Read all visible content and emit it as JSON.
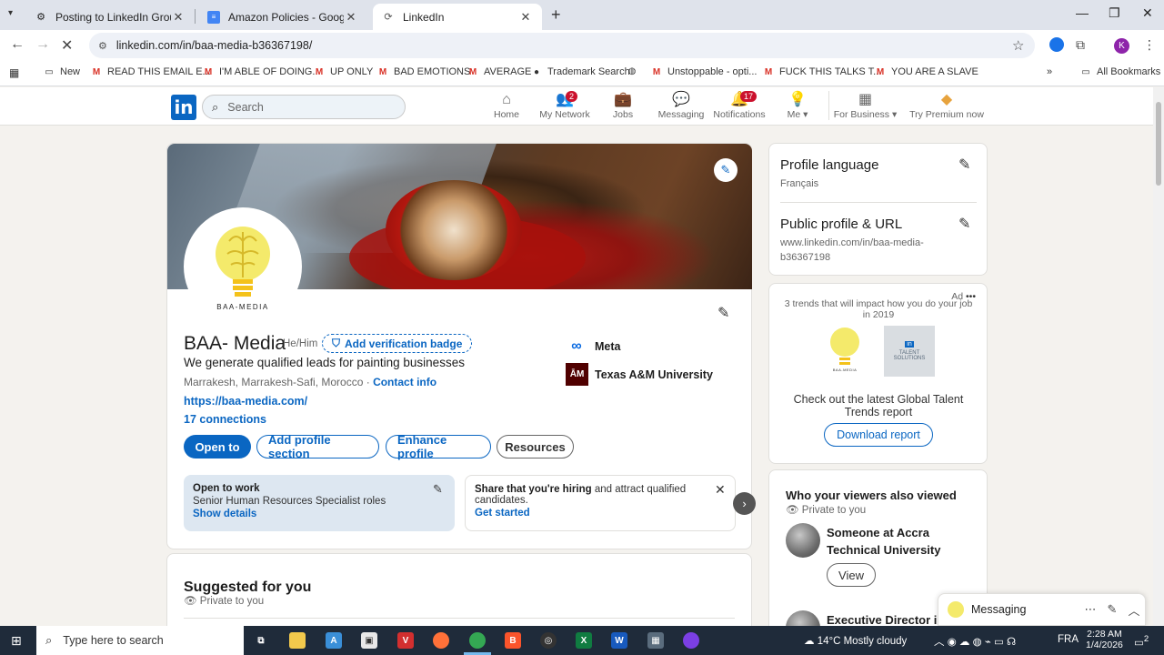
{
  "browser": {
    "tabs": [
      {
        "label": "Posting to LinkedIn Groups",
        "icon": "gear-icon"
      },
      {
        "label": "Amazon Policies - Google Docs",
        "icon": "docs-icon"
      },
      {
        "label": "LinkedIn",
        "icon": "linkedin-icon"
      }
    ],
    "url": "linkedin.com/in/baa-media-b36367198/",
    "bookmarks": [
      {
        "label": "New",
        "icon": "folder-icon"
      },
      {
        "label": "READ THIS EMAIL E...",
        "icon": "gmail-icon"
      },
      {
        "label": "I'M ABLE OF DOING...",
        "icon": "gmail-icon"
      },
      {
        "label": "UP ONLY",
        "icon": "gmail-icon"
      },
      {
        "label": "BAD EMOTIONS",
        "icon": "gmail-icon"
      },
      {
        "label": "AVERAGE",
        "icon": "gmail-icon"
      },
      {
        "label": "Trademark Search",
        "icon": "pin-icon"
      },
      {
        "label": "",
        "icon": "globe-icon"
      },
      {
        "label": "Unstoppable - opti...",
        "icon": "gmail-icon"
      },
      {
        "label": "FUCK THIS TALKS T...",
        "icon": "gmail-icon"
      },
      {
        "label": "YOU ARE A SLAVE",
        "icon": "gmail-icon"
      }
    ],
    "all_bookmarks": "All Bookmarks",
    "profile_initial": "K"
  },
  "linkedin": {
    "search_placeholder": "Search",
    "nav": [
      {
        "label": "Home"
      },
      {
        "label": "My Network",
        "badge": "2"
      },
      {
        "label": "Jobs"
      },
      {
        "label": "Messaging"
      },
      {
        "label": "Notifications",
        "badge": "17"
      },
      {
        "label": "Me ▾"
      },
      {
        "label": "For Business ▾"
      },
      {
        "label": "Try Premium now"
      }
    ]
  },
  "profile": {
    "logo_caption": "BAA-MEDIA",
    "name": "BAA- Media",
    "pronouns": "He/Him",
    "verify_label": "Add verification badge",
    "headline": "We generate qualified leads for painting businesses",
    "location": "Marrakesh, Marrakesh-Safi, Morocco",
    "location_sep": " · ",
    "contact_info": "Contact info",
    "website": "https://baa-media.com/",
    "connections": "17 connections",
    "buttons": {
      "open_to": "Open to",
      "add_section": "Add profile section",
      "enhance": "Enhance profile",
      "resources": "Resources"
    },
    "experience": [
      {
        "name": "Meta",
        "logo": "∞"
      },
      {
        "name": "Texas A&M University",
        "logo": "ĀM"
      }
    ],
    "open_to_work": {
      "title": "Open to work",
      "roles": "Senior Human Resources Specialist roles",
      "link": "Show details"
    },
    "hiring": {
      "bold": "Share that you're hiring",
      "rest": " and attract qualified candidates.",
      "link": "Get started"
    }
  },
  "suggested": {
    "title": "Suggested for you",
    "private": "Private to you"
  },
  "sidebar": {
    "profile_language": {
      "title": "Profile language",
      "value": "Français"
    },
    "public_profile": {
      "title": "Public profile & URL",
      "line1": "www.linkedin.com/in/baa-media-",
      "line2": "b36367198"
    },
    "ad": {
      "label": "Ad",
      "headline": "3 trends that will impact how you do your job in 2019",
      "logo_caption": "BAA-MEDIA",
      "logo2_line1": "TALENT",
      "logo2_line2": "SOLUTIONS",
      "cta": "Check out the latest Global Talent Trends report",
      "button": "Download report"
    },
    "viewers": {
      "title": "Who your viewers also viewed",
      "private": "Private to you",
      "person1": "Someone at Accra Technical University",
      "view_button": "View",
      "person2": "Executive Director in"
    },
    "messaging": "Messaging"
  },
  "taskbar": {
    "search_placeholder": "Type here to search",
    "weather": "14°C  Mostly cloudy",
    "language": "FRA",
    "time": "2:28 AM",
    "date": "1/4/2026",
    "notifications": "2"
  },
  "colors": {
    "linkedin_blue": "#0a66c2",
    "badge_red": "#cb112d",
    "taskbar": "#1f2b3a"
  }
}
